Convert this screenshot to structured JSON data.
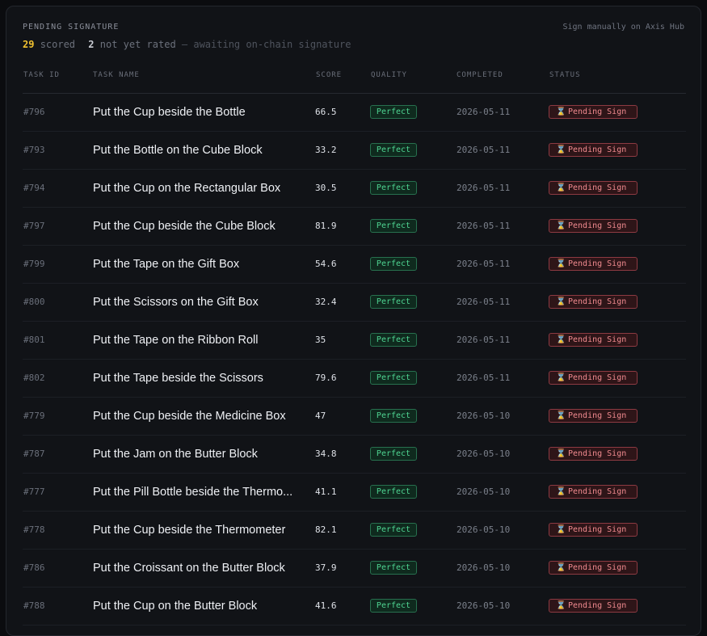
{
  "header": {
    "title": "PENDING SIGNATURE",
    "link_label": "Sign manually on Axis Hub"
  },
  "summary": {
    "scored_count": "29",
    "scored_label": "scored",
    "unrated_count": "2",
    "unrated_label": "not yet rated",
    "note": "— awaiting on-chain signature"
  },
  "columns": {
    "task_id": "TASK ID",
    "task_name": "TASK NAME",
    "score": "SCORE",
    "quality": "QUALITY",
    "completed": "COMPLETED",
    "status": "STATUS"
  },
  "colors": {
    "scored_accent": "#f2c230",
    "quality_green": "#4fd592",
    "status_red": "#f08a8f"
  },
  "rows": [
    {
      "id": "#796",
      "name": "Put the Cup beside the Bottle",
      "score": "66.5",
      "quality": "Perfect",
      "completed": "2026-05-11",
      "status": "Pending Sign",
      "status_icon": "hourglass-icon"
    },
    {
      "id": "#793",
      "name": "Put the Bottle on the Cube Block",
      "score": "33.2",
      "quality": "Perfect",
      "completed": "2026-05-11",
      "status": "Pending Sign",
      "status_icon": "hourglass-icon"
    },
    {
      "id": "#794",
      "name": "Put the Cup on the Rectangular Box",
      "score": "30.5",
      "quality": "Perfect",
      "completed": "2026-05-11",
      "status": "Pending Sign",
      "status_icon": "hourglass-icon"
    },
    {
      "id": "#797",
      "name": "Put the Cup beside the Cube Block",
      "score": "81.9",
      "quality": "Perfect",
      "completed": "2026-05-11",
      "status": "Pending Sign",
      "status_icon": "hourglass-icon"
    },
    {
      "id": "#799",
      "name": "Put the Tape on the Gift Box",
      "score": "54.6",
      "quality": "Perfect",
      "completed": "2026-05-11",
      "status": "Pending Sign",
      "status_icon": "hourglass-icon"
    },
    {
      "id": "#800",
      "name": "Put the Scissors on the Gift Box",
      "score": "32.4",
      "quality": "Perfect",
      "completed": "2026-05-11",
      "status": "Pending Sign",
      "status_icon": "hourglass-icon"
    },
    {
      "id": "#801",
      "name": "Put the Tape on the Ribbon Roll",
      "score": "35",
      "quality": "Perfect",
      "completed": "2026-05-11",
      "status": "Pending Sign",
      "status_icon": "hourglass-icon"
    },
    {
      "id": "#802",
      "name": "Put the Tape beside the Scissors",
      "score": "79.6",
      "quality": "Perfect",
      "completed": "2026-05-11",
      "status": "Pending Sign",
      "status_icon": "hourglass-icon"
    },
    {
      "id": "#779",
      "name": "Put the Cup beside the Medicine Box",
      "score": "47",
      "quality": "Perfect",
      "completed": "2026-05-10",
      "status": "Pending Sign",
      "status_icon": "hourglass-icon"
    },
    {
      "id": "#787",
      "name": "Put the Jam on the Butter Block",
      "score": "34.8",
      "quality": "Perfect",
      "completed": "2026-05-10",
      "status": "Pending Sign",
      "status_icon": "hourglass-icon"
    },
    {
      "id": "#777",
      "name": "Put the Pill Bottle beside the Thermo...",
      "score": "41.1",
      "quality": "Perfect",
      "completed": "2026-05-10",
      "status": "Pending Sign",
      "status_icon": "hourglass-icon"
    },
    {
      "id": "#778",
      "name": "Put the Cup beside the Thermometer",
      "score": "82.1",
      "quality": "Perfect",
      "completed": "2026-05-10",
      "status": "Pending Sign",
      "status_icon": "hourglass-icon"
    },
    {
      "id": "#786",
      "name": "Put the Croissant on the Butter Block",
      "score": "37.9",
      "quality": "Perfect",
      "completed": "2026-05-10",
      "status": "Pending Sign",
      "status_icon": "hourglass-icon"
    },
    {
      "id": "#788",
      "name": "Put the Cup on the Butter Block",
      "score": "41.6",
      "quality": "Perfect",
      "completed": "2026-05-10",
      "status": "Pending Sign",
      "status_icon": "hourglass-icon"
    }
  ]
}
